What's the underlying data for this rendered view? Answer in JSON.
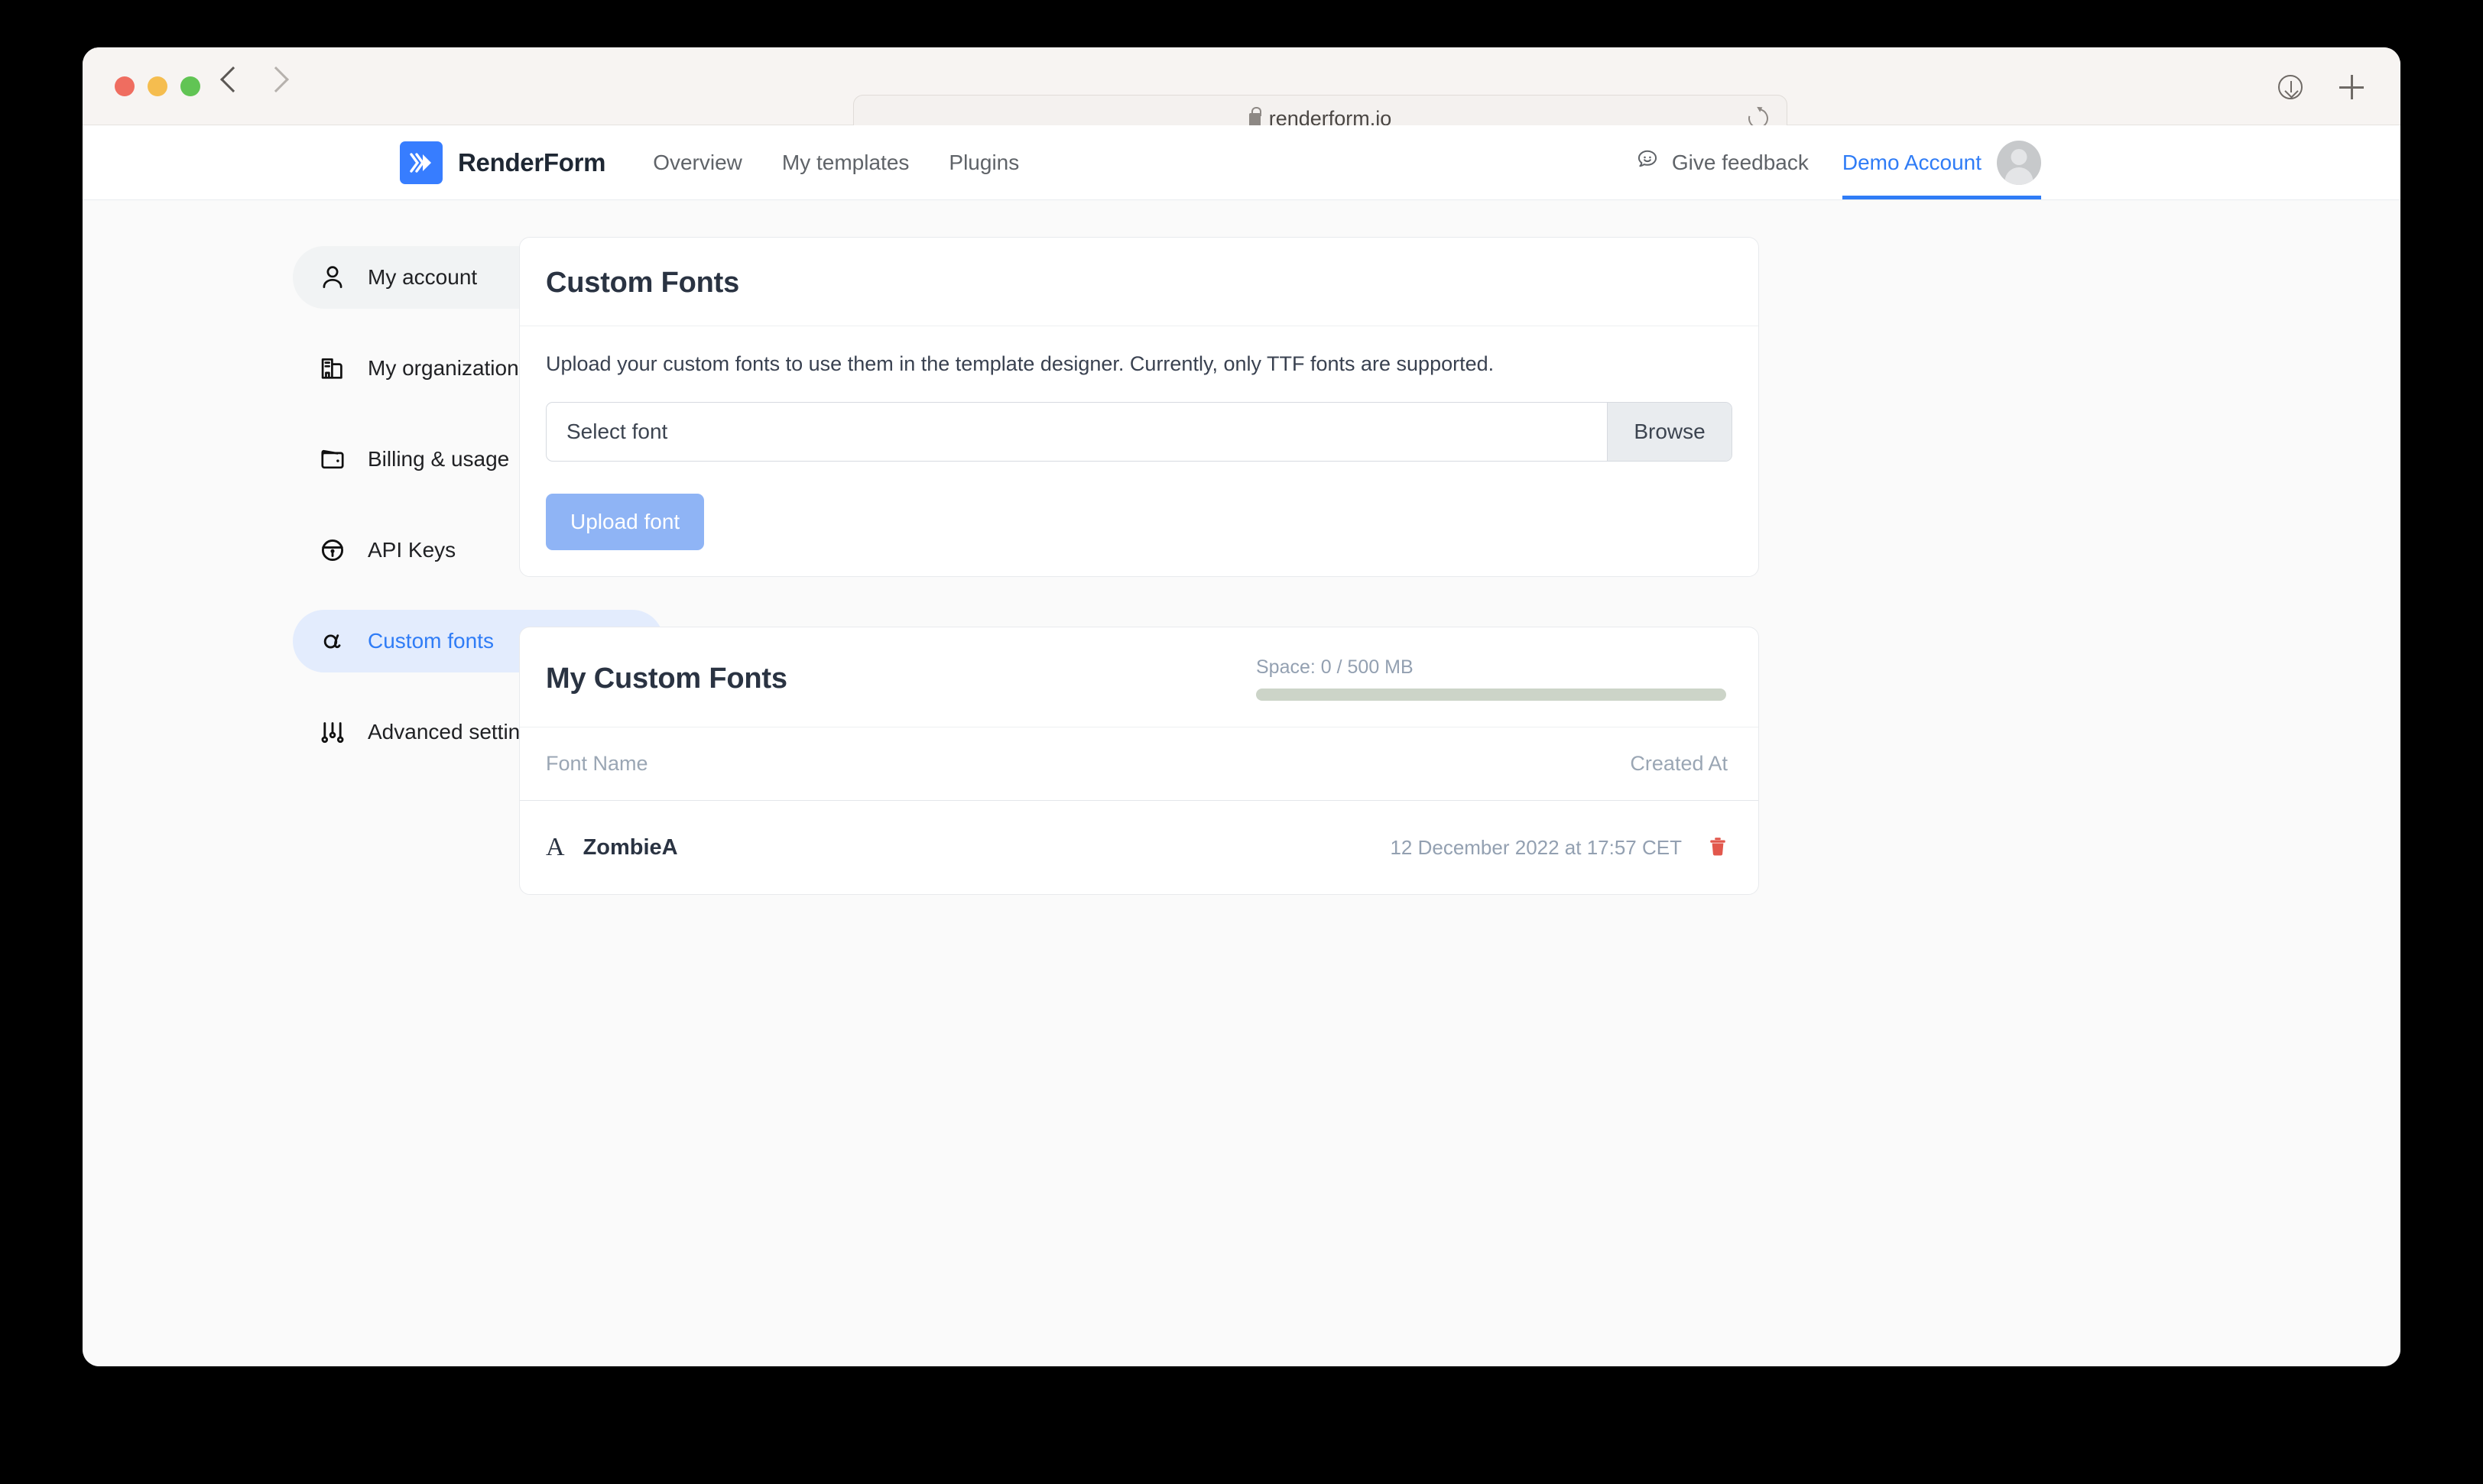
{
  "browser": {
    "url": "renderform.io",
    "lock_icon": "lock-icon",
    "reload_icon": "reload-icon",
    "back_icon": "back-chevron-icon",
    "forward_icon": "forward-chevron-icon",
    "downloads_icon": "downloads-icon",
    "new_tab_icon": "plus-icon"
  },
  "header": {
    "brand": "RenderForm",
    "logo_icon": "renderform-logo-icon",
    "accent_color": "#377dff",
    "nav": [
      {
        "label": "Overview"
      },
      {
        "label": "My templates"
      },
      {
        "label": "Plugins"
      }
    ],
    "feedback": {
      "label": "Give feedback",
      "icon": "chat-smiley-icon"
    },
    "account": {
      "label": "Demo Account",
      "active_color": "#2f7cf6",
      "avatar_icon": "avatar"
    }
  },
  "sidebar": {
    "items": [
      {
        "label": "My account",
        "icon": "person-icon",
        "state": "hover"
      },
      {
        "label": "My organization",
        "icon": "building-icon",
        "state": "normal"
      },
      {
        "label": "Billing & usage",
        "icon": "wallet-icon",
        "state": "normal"
      },
      {
        "label": "API Keys",
        "icon": "lock-icon",
        "state": "normal"
      },
      {
        "label": "Custom fonts",
        "icon": "alpha-icon",
        "state": "active"
      },
      {
        "label": "Advanced settings",
        "icon": "sliders-icon",
        "state": "normal"
      }
    ]
  },
  "upload_card": {
    "title": "Custom Fonts",
    "description": "Upload your custom fonts to use them in the template designer. Currently, only TTF fonts are supported.",
    "file_placeholder": "Select font",
    "browse_label": "Browse",
    "upload_label": "Upload font"
  },
  "fonts_card": {
    "title": "My Custom Fonts",
    "space_label": "Space: 0 / 500 MB",
    "space_used_mb": 0,
    "space_total_mb": 500,
    "space_percent": 0,
    "space_track_color": "#ccd4c8",
    "columns": {
      "name": "Font Name",
      "created": "Created At"
    },
    "rows": [
      {
        "glyph": "A",
        "name": "ZombieA",
        "created_at": "12 December 2022 at 17:57 CET",
        "delete_icon": "trash-icon",
        "delete_color": "#e2574c"
      }
    ]
  }
}
